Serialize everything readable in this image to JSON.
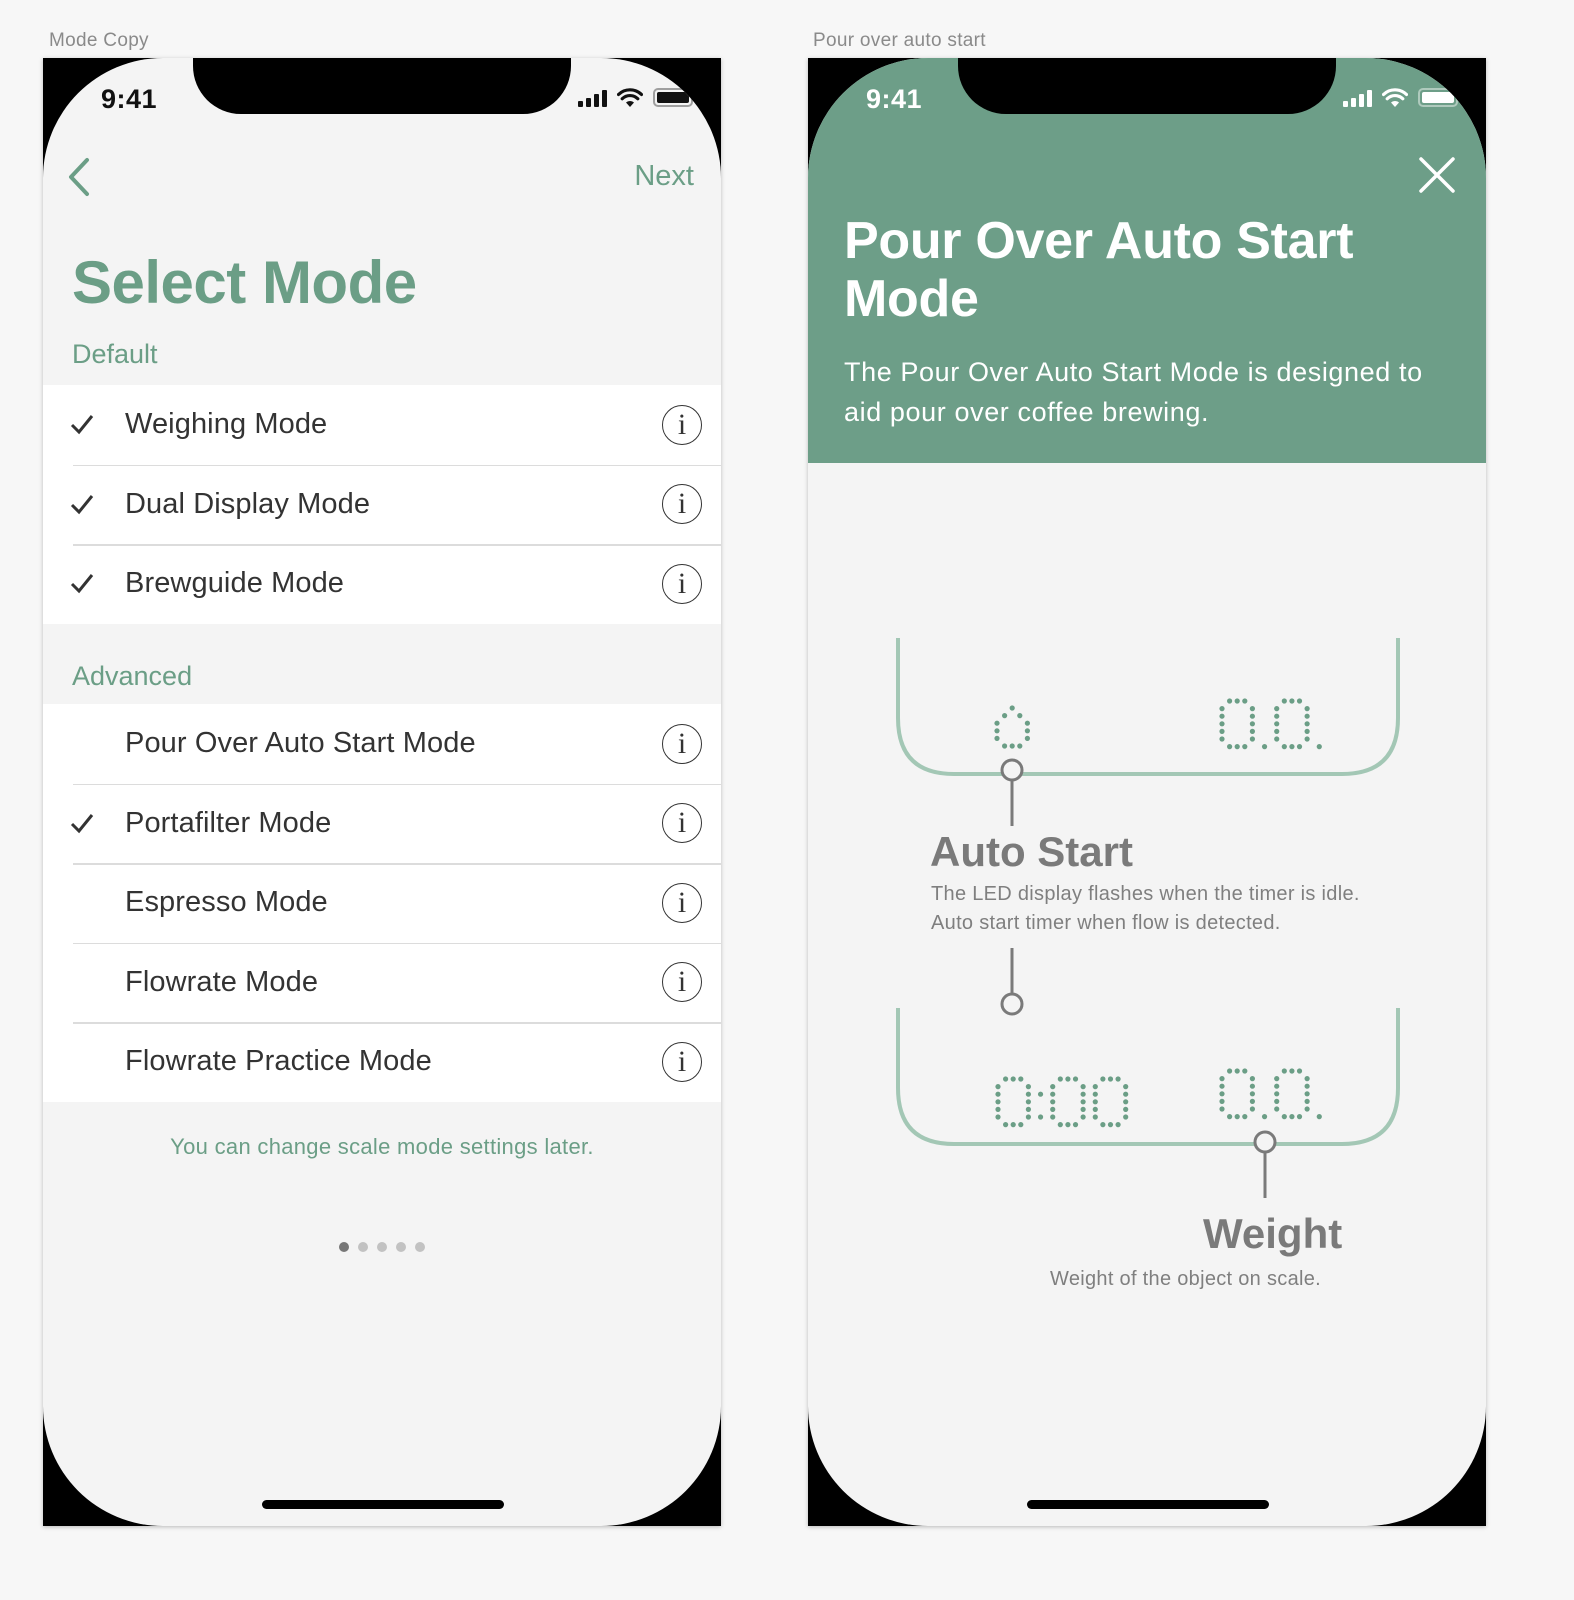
{
  "artboards": [
    {
      "label": "Mode Copy"
    },
    {
      "label": "Pour over auto start"
    }
  ],
  "status_bar": {
    "time": "9:41"
  },
  "colors": {
    "accent": "#6b9e86",
    "hero_bg": "#6d9e88",
    "scale_outline": "#a3c7b5",
    "led_dot": "#6b9e86"
  },
  "select_mode": {
    "nav": {
      "back_icon": "chevron-left-icon",
      "next_label": "Next"
    },
    "title": "Select Mode",
    "sections": [
      {
        "header": "Default",
        "items": [
          {
            "label": "Weighing Mode",
            "checked": true
          },
          {
            "label": "Dual Display Mode",
            "checked": true
          },
          {
            "label": "Brewguide Mode",
            "checked": true
          }
        ]
      },
      {
        "header": "Advanced",
        "items": [
          {
            "label": "Pour Over Auto Start Mode",
            "checked": false
          },
          {
            "label": "Portafilter Mode",
            "checked": true
          },
          {
            "label": "Espresso Mode",
            "checked": false
          },
          {
            "label": "Flowrate Mode",
            "checked": false
          },
          {
            "label": "Flowrate Practice Mode",
            "checked": false
          }
        ]
      }
    ],
    "info_icon_glyph": "i",
    "footnote": "You can change scale mode settings later.",
    "pager": {
      "total": 5,
      "current": 1
    }
  },
  "pour_over": {
    "close_icon": "close-icon",
    "title": "Pour Over Auto Start Mode",
    "description": "The Pour Over Auto Start Mode is designed to aid pour over coffee brewing.",
    "display_top": {
      "left": "drop",
      "right": "0.0."
    },
    "display_bottom": {
      "left": "0:00",
      "right": "0.0."
    },
    "callouts": [
      {
        "title": "Auto Start",
        "text_lines": [
          "The LED display flashes when the timer is idle.",
          "Auto start timer when flow is detected."
        ]
      },
      {
        "title": "Weight",
        "text_lines": [
          "Weight of the object on scale."
        ]
      }
    ]
  }
}
